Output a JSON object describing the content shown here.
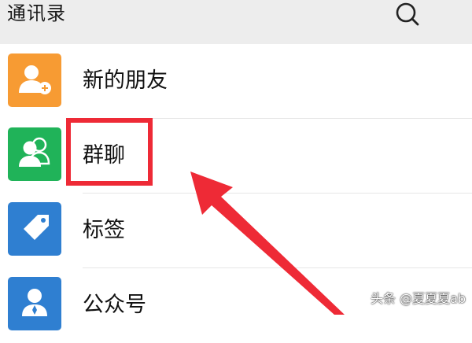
{
  "header": {
    "title": "通讯录",
    "search_icon": "search-icon",
    "background": "#ededed"
  },
  "list": {
    "items": [
      {
        "label": "新的朋友",
        "icon": "add-friend-icon",
        "tile_color": "#f79b33"
      },
      {
        "label": "群聊",
        "icon": "group-chat-icon",
        "tile_color": "#20b359",
        "highlighted": true
      },
      {
        "label": "标签",
        "icon": "tag-icon",
        "tile_color": "#2f7fd1"
      },
      {
        "label": "公众号",
        "icon": "official-account-icon",
        "tile_color": "#2f7fd1"
      }
    ]
  },
  "annotation": {
    "box_color": "#ee2a36",
    "arrow_color": "#ee2a36"
  },
  "watermark": {
    "text": "头条 @夏夏夏ab"
  }
}
